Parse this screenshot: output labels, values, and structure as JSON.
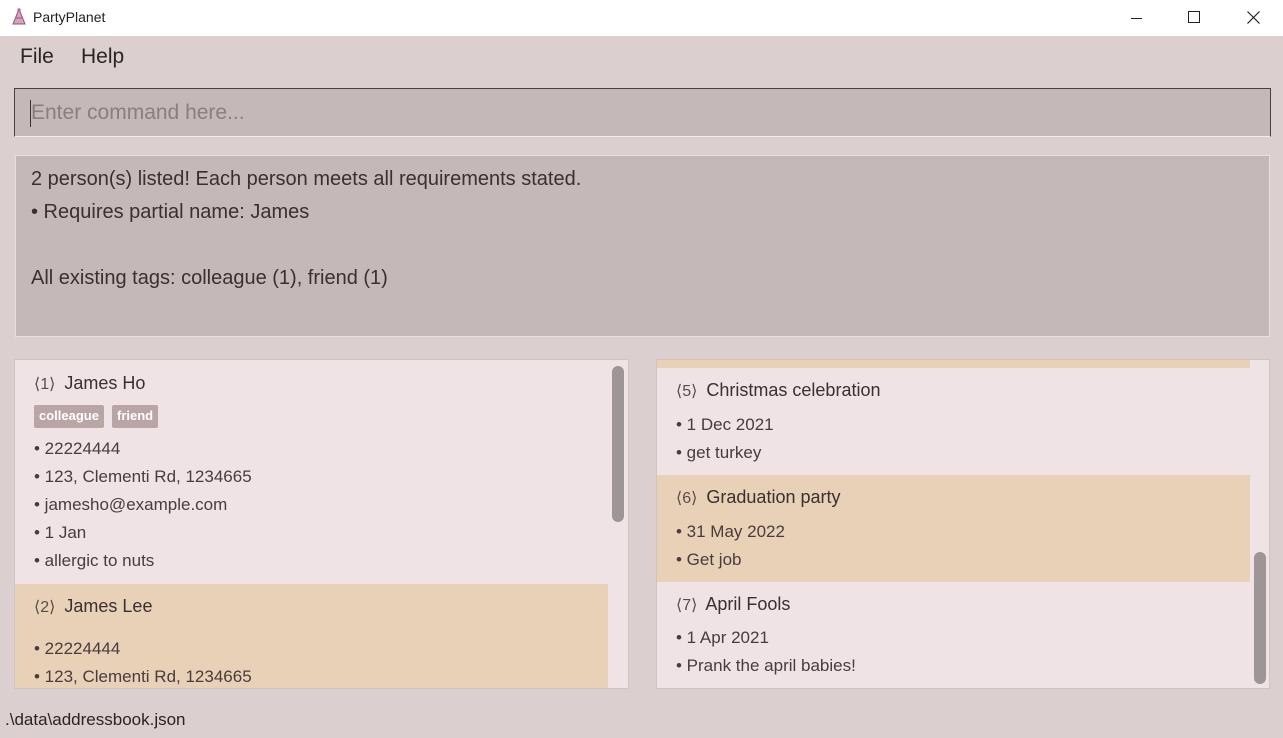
{
  "window": {
    "title": "PartyPlanet",
    "icon": "party-hat-icon",
    "controls": {
      "minimize": "minimize-icon",
      "maximize": "maximize-icon",
      "close": "close-icon"
    }
  },
  "menu": {
    "file": "File",
    "help": "Help"
  },
  "command": {
    "placeholder": "Enter command here...",
    "value": ""
  },
  "result": {
    "line1": "2 person(s) listed! Each person meets all requirements stated.",
    "line2": "• Requires partial name: James",
    "line3": "All existing tags: colleague (1), friend (1)"
  },
  "persons": [
    {
      "index": "⟨1⟩",
      "name": "James Ho",
      "tags": [
        "colleague",
        "friend"
      ],
      "phone": "• 22224444",
      "address": "• 123, Clementi Rd, 1234665",
      "email": "• jamesho@example.com",
      "birthday": "• 1 Jan",
      "remark": "• allergic to nuts"
    },
    {
      "index": "⟨2⟩",
      "name": "James Lee",
      "phone": "• 22224444",
      "address": "• 123, Clementi Rd, 1234665"
    }
  ],
  "events": [
    {
      "index": "⟨5⟩",
      "name": "Christmas celebration",
      "date": "• 1 Dec 2021",
      "detail": "• get turkey"
    },
    {
      "index": "⟨6⟩",
      "name": "Graduation party",
      "date": "• 31 May 2022",
      "detail": "• Get job"
    },
    {
      "index": "⟨7⟩",
      "name": "April Fools",
      "date": "• 1 Apr 2021",
      "detail": "• Prank the april babies!"
    }
  ],
  "status": {
    "path": ".\\data\\addressbook.json"
  },
  "colors": {
    "background": "#dbcfcf",
    "card": "#f0e3e6",
    "card_alt": "#e9d1b8",
    "tag": "#b9a5a5",
    "input": "#c5b8b8"
  }
}
